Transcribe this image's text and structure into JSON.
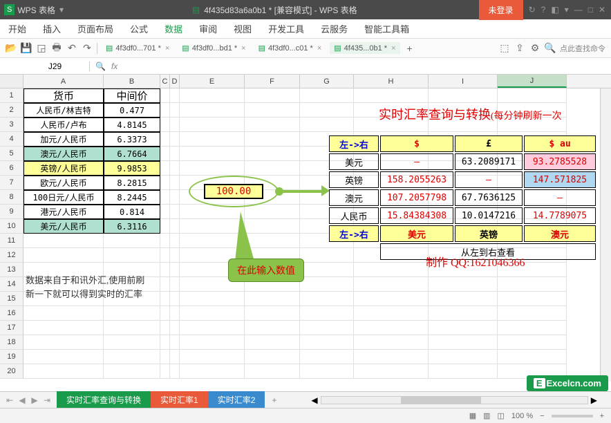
{
  "titlebar": {
    "app_name": "WPS 表格",
    "doc_name": "4f435d83a6a0b1 * [兼容模式] - WPS 表格",
    "login": "未登录"
  },
  "menu": {
    "items": [
      "开始",
      "插入",
      "页面布局",
      "公式",
      "数据",
      "审阅",
      "视图",
      "开发工具",
      "云服务",
      "智能工具箱"
    ],
    "active_index": 4
  },
  "doc_tabs": [
    {
      "name": "4f3df0...701 *"
    },
    {
      "name": "4f3df0...bd1 *"
    },
    {
      "name": "4f3df0...c01 *"
    },
    {
      "name": "4f435...0b1 *",
      "active": true
    }
  ],
  "search_placeholder": "点此查找命令",
  "formula_bar": {
    "cell_ref": "J29",
    "fx_label": "fx"
  },
  "columns": [
    "A",
    "B",
    "C",
    "D",
    "E",
    "F",
    "G",
    "H",
    "I",
    "J"
  ],
  "row_count": 20,
  "rate_table": {
    "headers": {
      "col1": "货币",
      "col2": "中间价"
    },
    "rows": [
      {
        "c": "人民币/林吉特",
        "v": "0.477"
      },
      {
        "c": "人民币/卢布",
        "v": "4.8145"
      },
      {
        "c": "加元/人民币",
        "v": "6.3373"
      },
      {
        "c": "澳元/人民币",
        "v": "6.7664",
        "hl": true
      },
      {
        "c": "英镑/人民币",
        "v": "9.9853",
        "yl": true
      },
      {
        "c": "欧元/人民币",
        "v": "8.2815"
      },
      {
        "c": "100日元/人民币",
        "v": "8.2445"
      },
      {
        "c": "港元/人民币",
        "v": "0.814"
      },
      {
        "c": "美元/人民币",
        "v": "6.3116",
        "hl": true
      }
    ]
  },
  "input_value": "100.00",
  "main_title": "实时汇率查询与转换",
  "main_title_sub": "(每分钟刷新一次",
  "conversion": {
    "lr_label": "左->右",
    "col_symbols": [
      "$",
      "£",
      "$ au"
    ],
    "rows": [
      {
        "name": "美元",
        "cells": [
          "–",
          "63.2089171",
          "93.2785528"
        ],
        "hl": [
          false,
          false,
          true
        ]
      },
      {
        "name": "英镑",
        "cells": [
          "158.2055263",
          "–",
          "147.571825"
        ],
        "hl": [
          true,
          false,
          true
        ],
        "bg": "blue"
      },
      {
        "name": "澳元",
        "cells": [
          "107.2057798",
          "67.7636125",
          "–"
        ],
        "hl": [
          true,
          false,
          false
        ]
      },
      {
        "name": "人民币",
        "cells": [
          "15.84384308",
          "10.0147216",
          "14.7789075"
        ],
        "hl": [
          true,
          false,
          true
        ]
      }
    ],
    "footer_labels": [
      "美元",
      "英镑",
      "澳元"
    ],
    "view_hint": "从左到右查看"
  },
  "callout": "在此输入数值",
  "note_line1": "数据来自于和讯外汇,使用前刷",
  "note_line2": "新一下就可以得到实时的汇率",
  "credit": "制作 QQ:1621046366",
  "sheet_tabs": [
    "实时汇率查询与转换",
    "实时汇率1",
    "实时汇率2"
  ],
  "status": {
    "zoom": "100 %"
  },
  "watermark": "Excelcn.com",
  "chart_data": {
    "type": "table",
    "title": "实时汇率查询与转换",
    "rate_table": {
      "columns": [
        "货币",
        "中间价"
      ],
      "data": [
        [
          "人民币/林吉特",
          0.477
        ],
        [
          "人民币/卢布",
          4.8145
        ],
        [
          "加元/人民币",
          6.3373
        ],
        [
          "澳元/人民币",
          6.7664
        ],
        [
          "英镑/人民币",
          9.9853
        ],
        [
          "欧元/人民币",
          8.2815
        ],
        [
          "100日元/人民币",
          8.2445
        ],
        [
          "港元/人民币",
          0.814
        ],
        [
          "美元/人民币",
          6.3116
        ]
      ]
    },
    "input_amount": 100.0,
    "conversion_matrix": {
      "from": [
        "美元",
        "英镑",
        "澳元",
        "人民币"
      ],
      "to": [
        "$",
        "£",
        "$ au"
      ],
      "values": [
        [
          null,
          63.2089171,
          93.2785528
        ],
        [
          158.2055263,
          null,
          147.571825
        ],
        [
          107.2057798,
          67.7636125,
          null
        ],
        [
          15.84384308,
          10.0147216,
          14.7789075
        ]
      ]
    }
  }
}
